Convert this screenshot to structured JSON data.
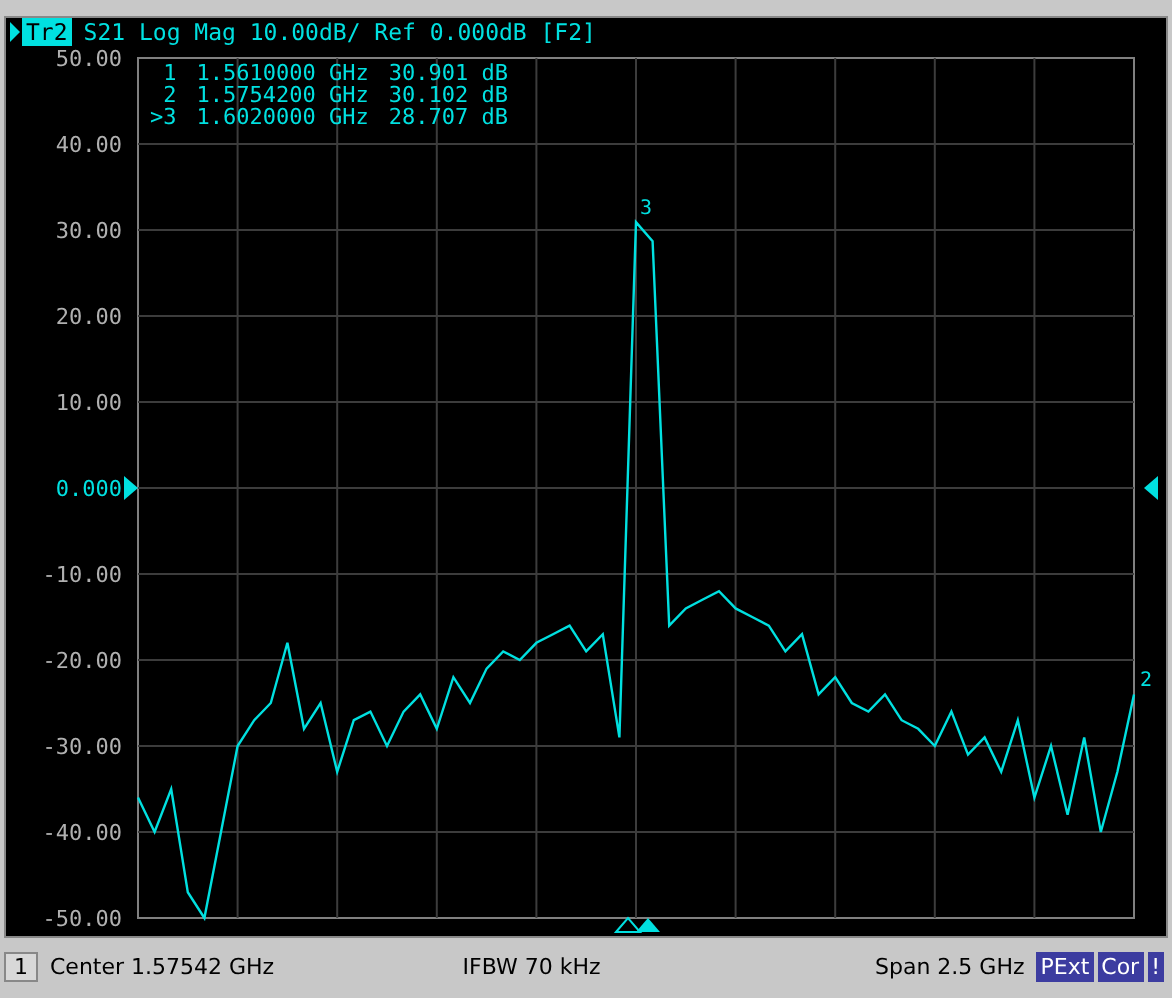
{
  "header": {
    "trace": "Tr2",
    "text": "S21 Log Mag 10.00dB/ Ref 0.000dB [F2]"
  },
  "markers": [
    {
      "label": "1",
      "frequency": "1.5610000 GHz",
      "value": "30.901 dB"
    },
    {
      "label": "2",
      "frequency": "1.5754200 GHz",
      "value": "30.102 dB"
    },
    {
      "label": ">3",
      "frequency": "1.6020000 GHz",
      "value": "28.707 dB"
    }
  ],
  "chart_data": {
    "type": "line",
    "grid": true,
    "ylim": [
      -50,
      50
    ],
    "yticks": [
      {
        "value": 50,
        "label": "50.00"
      },
      {
        "value": 40,
        "label": "40.00"
      },
      {
        "value": 30,
        "label": "30.00"
      },
      {
        "value": 20,
        "label": "20.00"
      },
      {
        "value": 10,
        "label": "10.00"
      },
      {
        "value": 0,
        "label": "0.000"
      },
      {
        "value": -10,
        "label": "-10.00"
      },
      {
        "value": -20,
        "label": "-20.00"
      },
      {
        "value": -30,
        "label": "-30.00"
      },
      {
        "value": -40,
        "label": "-40.00"
      },
      {
        "value": -50,
        "label": "-50.00"
      }
    ],
    "categories": [
      null,
      null,
      null,
      null,
      null,
      null,
      null,
      null,
      null,
      null,
      null,
      null,
      null,
      null,
      null,
      null,
      null,
      null,
      null,
      null,
      null,
      null,
      null,
      null,
      null,
      null,
      null,
      null,
      null,
      null,
      null,
      null,
      null,
      null,
      null,
      null,
      null,
      null,
      null,
      null,
      null,
      null,
      null,
      null,
      null,
      null,
      null,
      null,
      null,
      null,
      null,
      null,
      null,
      null,
      null,
      null,
      null,
      null,
      null,
      null,
      null
    ],
    "series": [
      {
        "color": "#00e0e0",
        "values": [
          -36,
          -40,
          -35,
          -47,
          -50,
          -40,
          -30,
          -27,
          -25,
          -18,
          -28,
          -25,
          -33,
          -27,
          -26,
          -30,
          -26,
          -24,
          -28,
          -22,
          -25,
          -21,
          -19,
          -20,
          -18,
          -17,
          -16,
          -19,
          -17,
          -29,
          30.9,
          28.7,
          -16,
          -14,
          -13,
          -12,
          -14,
          -15,
          -16,
          -19,
          -17,
          -24,
          -22,
          -25,
          -26,
          -24,
          -27,
          -28,
          -30,
          -26,
          -31,
          -29,
          -33,
          -27,
          -36,
          -30,
          -38,
          -29,
          -40,
          -33,
          -24
        ]
      }
    ]
  },
  "plot_labels": [
    {
      "text": "3"
    },
    {
      "text": "2"
    }
  ],
  "status_bar": {
    "channel": "1",
    "center": "Center 1.57542 GHz",
    "ifbw": "IFBW 70 kHz",
    "span": "Span 2.5 GHz",
    "badges": [
      "PExt",
      "Cor",
      "!"
    ]
  }
}
